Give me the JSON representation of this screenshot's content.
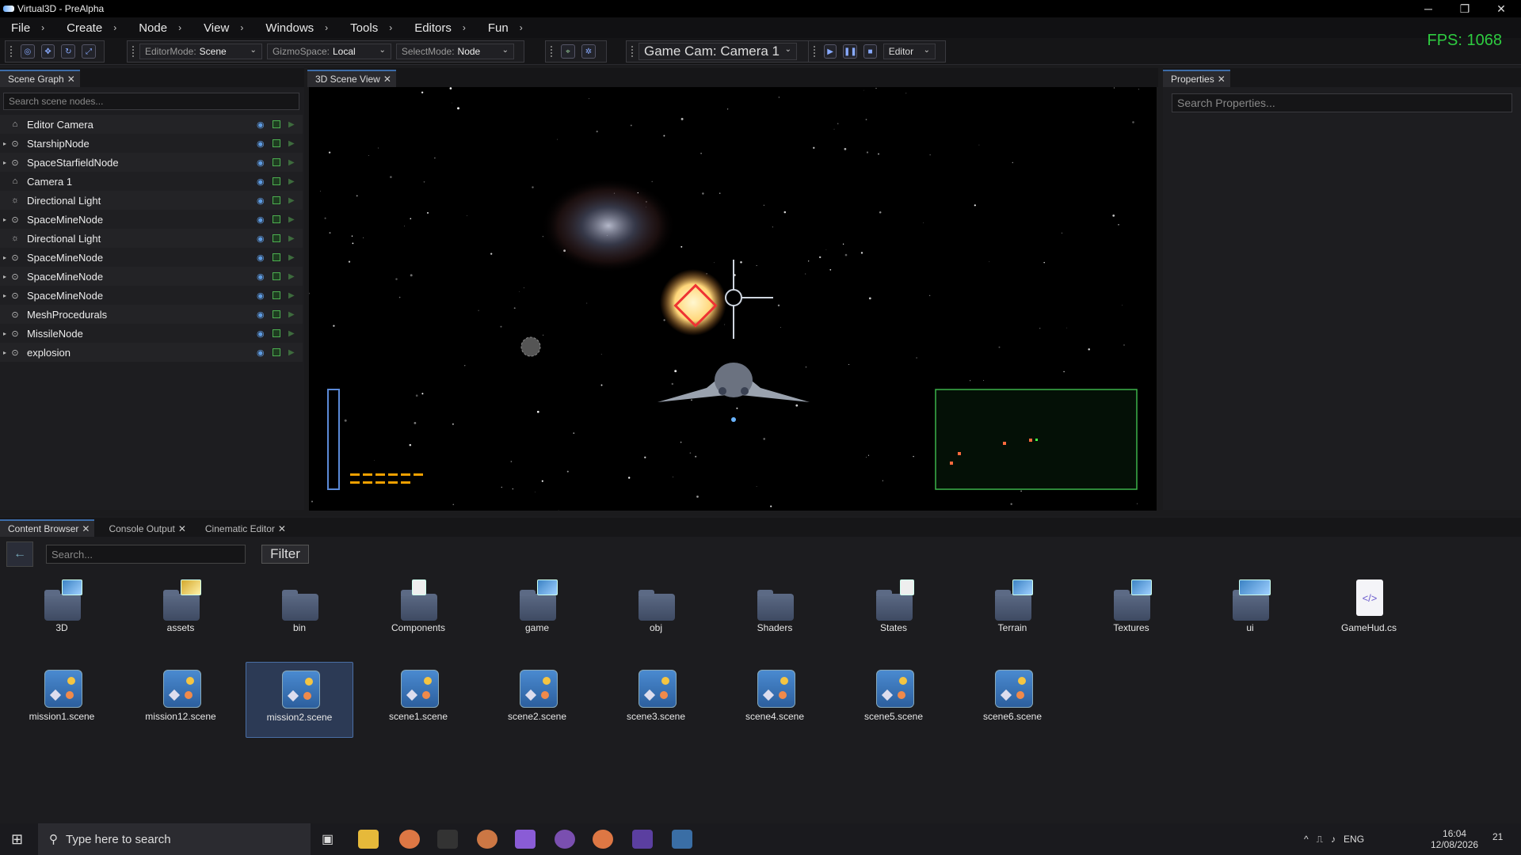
{
  "window": {
    "title": "Virtual3D - PreAlpha",
    "minimize": "─",
    "maximize": "❐",
    "close": "✕"
  },
  "menu": [
    {
      "label": "File"
    },
    {
      "label": "Create"
    },
    {
      "label": "Node"
    },
    {
      "label": "View"
    },
    {
      "label": "Windows"
    },
    {
      "label": "Tools"
    },
    {
      "label": "Editors"
    },
    {
      "label": "Fun"
    }
  ],
  "toolbar": {
    "editor_mode": {
      "label": "EditorMode:",
      "value": "Scene"
    },
    "gizmo_space": {
      "label": "GizmoSpace:",
      "value": "Local"
    },
    "select_mode": {
      "label": "SelectMode:",
      "value": "Node"
    },
    "camera": "Game Cam: Camera 1",
    "play_mode": "Editor"
  },
  "fps": "FPS: 1068",
  "scene_graph": {
    "tab": "Scene Graph",
    "search_placeholder": "Search scene nodes...",
    "nodes": [
      {
        "label": "Editor Camera",
        "icon": "camera-icon",
        "expandable": false
      },
      {
        "label": "StarshipNode",
        "icon": "node-icon",
        "expandable": true
      },
      {
        "label": "SpaceStarfieldNode",
        "icon": "node-icon",
        "expandable": true
      },
      {
        "label": "Camera 1",
        "icon": "camera-icon",
        "expandable": false
      },
      {
        "label": "Directional Light",
        "icon": "light-icon",
        "expandable": false
      },
      {
        "label": "SpaceMineNode",
        "icon": "node-icon",
        "expandable": true
      },
      {
        "label": "Directional Light",
        "icon": "light-icon",
        "expandable": false
      },
      {
        "label": "SpaceMineNode",
        "icon": "node-icon",
        "expandable": true
      },
      {
        "label": "SpaceMineNode",
        "icon": "node-icon",
        "expandable": true
      },
      {
        "label": "SpaceMineNode",
        "icon": "node-icon",
        "expandable": true
      },
      {
        "label": "MeshProcedurals",
        "icon": "node-icon",
        "expandable": false
      },
      {
        "label": "MissileNode",
        "icon": "node-icon",
        "expandable": true
      },
      {
        "label": "explosion",
        "icon": "node-icon",
        "expandable": true
      }
    ]
  },
  "viewport": {
    "tab": "3D Scene View"
  },
  "properties": {
    "tab": "Properties",
    "search_placeholder": "Search Properties..."
  },
  "bottom_tabs": [
    {
      "label": "Content Browser",
      "active": true
    },
    {
      "label": "Console Output",
      "active": false
    },
    {
      "label": "Cinematic Editor",
      "active": false
    }
  ],
  "content_browser": {
    "search_placeholder": "Search...",
    "filter_label": "Filter",
    "folders": [
      {
        "label": "3D"
      },
      {
        "label": "assets"
      },
      {
        "label": "bin"
      },
      {
        "label": "Components"
      },
      {
        "label": "game"
      },
      {
        "label": "obj"
      },
      {
        "label": "Shaders"
      },
      {
        "label": "States"
      },
      {
        "label": "Terrain"
      },
      {
        "label": "Textures"
      },
      {
        "label": "ui"
      },
      {
        "label": "GameHud.cs"
      }
    ],
    "scenes": [
      {
        "label": "mission1.scene"
      },
      {
        "label": "mission12.scene"
      },
      {
        "label": "mission2.scene"
      },
      {
        "label": "scene1.scene"
      },
      {
        "label": "scene2.scene"
      },
      {
        "label": "scene3.scene"
      },
      {
        "label": "scene4.scene"
      },
      {
        "label": "scene5.scene"
      },
      {
        "label": "scene6.scene"
      }
    ]
  },
  "taskbar": {
    "search_placeholder": "Type here to search",
    "lang": "ENG",
    "time": "16:04",
    "date": "12/08/2026",
    "notifications": "21"
  }
}
